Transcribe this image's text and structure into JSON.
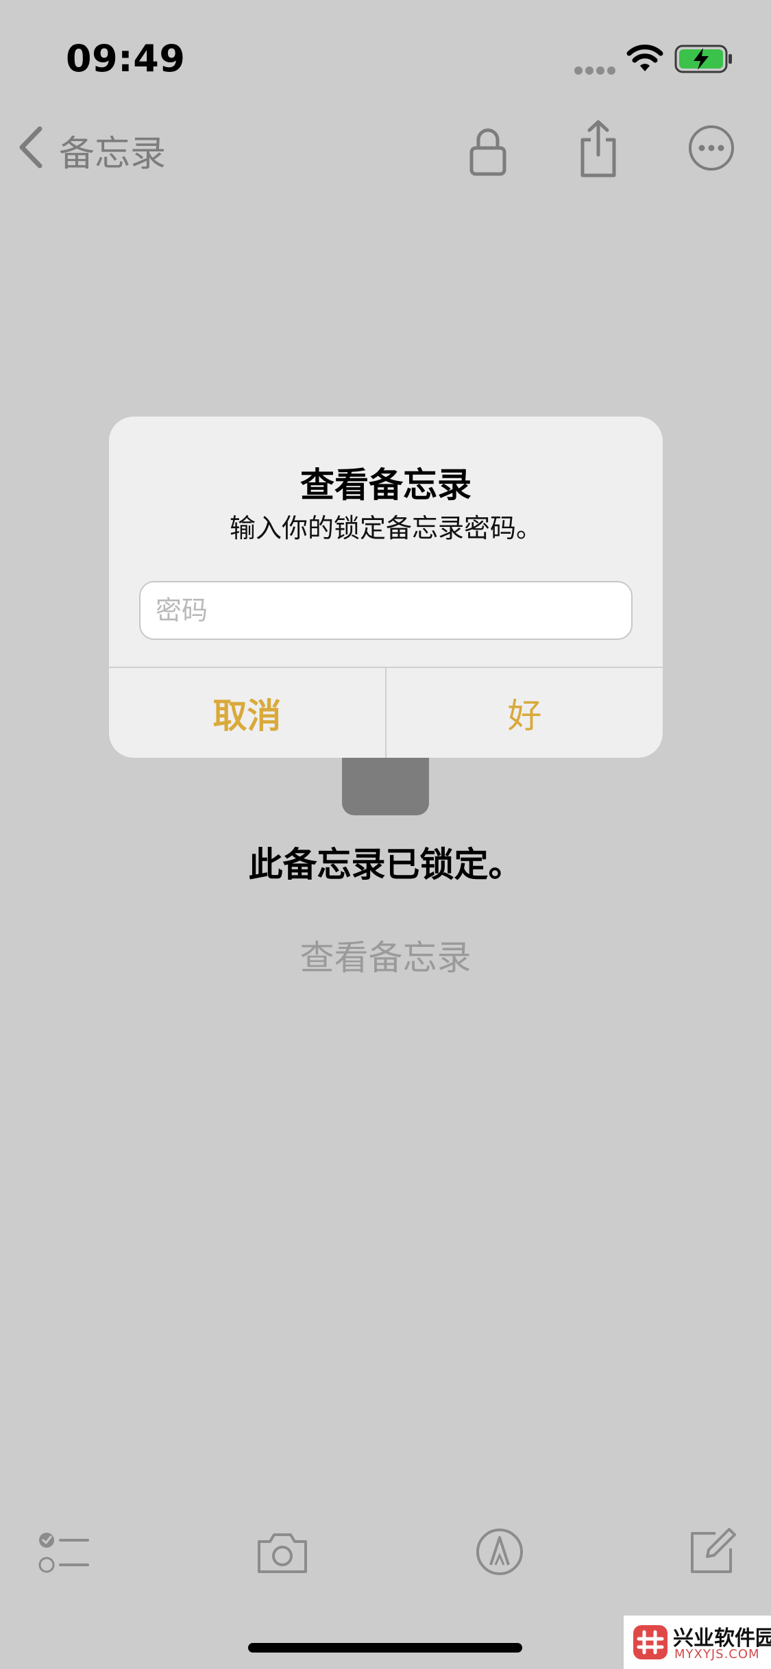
{
  "status_bar": {
    "time": "09:49",
    "icons": [
      "cellular-dots-icon",
      "wifi-icon",
      "battery-charging-icon"
    ],
    "battery_color": "#3ac24a"
  },
  "nav": {
    "back_label": "备忘录",
    "icons": [
      "chevron-left-icon",
      "lock-icon",
      "share-icon",
      "more-icon"
    ]
  },
  "note": {
    "locked_message": "此备忘录已锁定。",
    "view_link": "查看备忘录"
  },
  "alert": {
    "title": "查看备忘录",
    "message": "输入你的锁定备忘录密码。",
    "password_placeholder": "密码",
    "password_value": "",
    "cancel_label": "取消",
    "ok_label": "好",
    "accent_color": "#d9a93a"
  },
  "toolbar": {
    "icons": [
      "checklist-icon",
      "camera-icon",
      "markup-icon",
      "compose-icon"
    ]
  },
  "watermark": {
    "title": "兴业软件园",
    "subtitle": "MYXYJS.COM"
  }
}
